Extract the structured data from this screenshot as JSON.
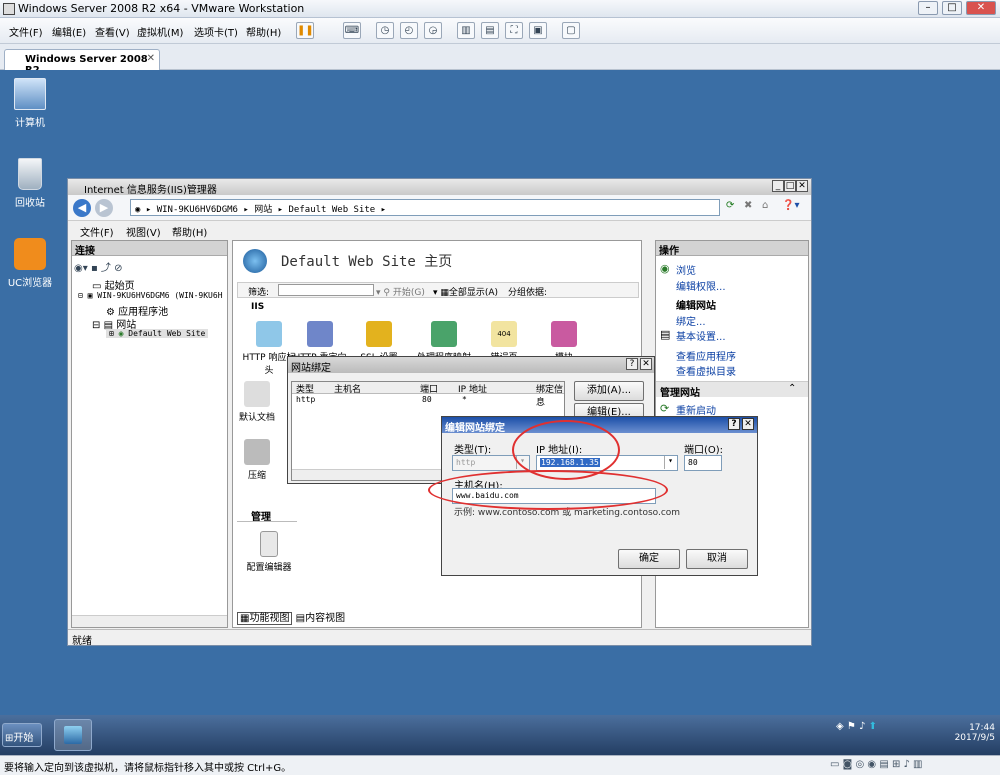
{
  "vmware": {
    "title": "Windows Server 2008 R2 x64 - VMware Workstation",
    "menu": [
      "文件(F)",
      "编辑(E)",
      "查看(V)",
      "虚拟机(M)",
      "选项卡(T)",
      "帮助(H)"
    ],
    "tab_label": "Windows Server 2008 R2 ...",
    "status_text": "要将输入定向到该虚拟机，请将鼠标指针移入其中或按 Ctrl+G。"
  },
  "desktop": {
    "icons": [
      {
        "label": "计算机"
      },
      {
        "label": "回收站"
      },
      {
        "label": "UC浏览器"
      }
    ]
  },
  "iis": {
    "title": "Internet 信息服务(IIS)管理器",
    "address": [
      "WIN-9KU6HV6DGM6",
      "网站",
      "Default Web Site"
    ],
    "menu": [
      "文件(F)",
      "视图(V)",
      "帮助(H)"
    ],
    "connections_header": "连接",
    "tree": {
      "start_page": "起始页",
      "server": "WIN-9KU6HV6DGM6 (WIN-9KU6H",
      "app_pools": "应用程序池",
      "sites": "网站",
      "default_site": "Default Web Site"
    },
    "main_title": "Default Web Site 主页",
    "filter_label": "筛选:",
    "go_label": "开始(G)",
    "show_all": "全部显示(A)",
    "group_by": "分组依据:",
    "section_iis": "IIS",
    "section_manage": "管理",
    "features": [
      "HTTP 响应标头",
      "HTTP 重定向",
      "SSL 设置",
      "处理程序映射",
      "错误页",
      "模块"
    ],
    "features_row2": [
      "默认文档",
      "压缩"
    ],
    "config_editor": "配置编辑器",
    "view_features": "功能视图",
    "view_content": "内容视图",
    "status": "就绪",
    "actions": {
      "header": "操作",
      "browse": "浏览",
      "edit_perms": "编辑权限...",
      "edit_site_hdr": "编辑网站",
      "bindings": "绑定...",
      "basic_settings": "基本设置...",
      "view_apps": "查看应用程序",
      "view_vdirs": "查看虚拟目录",
      "manage_site_hdr": "管理网站",
      "restart": "重新启动"
    }
  },
  "site_bindings": {
    "title": "网站绑定",
    "columns": [
      "类型",
      "主机名",
      "端口",
      "IP 地址",
      "绑定信息"
    ],
    "rows": [
      {
        "type": "http",
        "host": "",
        "port": "80",
        "ip": "*",
        "info": ""
      }
    ],
    "add_button": "添加(A)...",
    "edit_button": "编辑(E)..."
  },
  "edit_binding": {
    "title": "编辑网站绑定",
    "type_label": "类型(T):",
    "type_value": "http",
    "ip_label": "IP 地址(I):",
    "ip_value": "192.168.1.35",
    "port_label": "端口(O):",
    "port_value": "80",
    "host_label": "主机名(H):",
    "host_value": "www.baidu.com",
    "example": "示例: www.contoso.com 或 marketing.contoso.com",
    "ok": "确定",
    "cancel": "取消"
  },
  "taskbar": {
    "start": "开始",
    "time": "17:44",
    "date": "2017/9/5"
  },
  "colors": {
    "desktop": "#3a6ea5",
    "dialog_title": "#1c4fa8",
    "highlight_ring": "#e03030",
    "selection": "#316ac5"
  }
}
